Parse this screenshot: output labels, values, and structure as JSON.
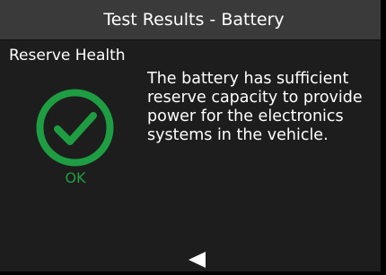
{
  "header": {
    "title": "Test Results - Battery"
  },
  "section": {
    "title": "Reserve Health"
  },
  "status": {
    "label": "OK",
    "icon": "check-circle-icon",
    "color": "#1f9d43"
  },
  "description": "The battery has sufficient reserve capacity to provide power for the electronics systems in the vehicle.",
  "navigation": {
    "back_icon": "triangle-left-icon"
  }
}
